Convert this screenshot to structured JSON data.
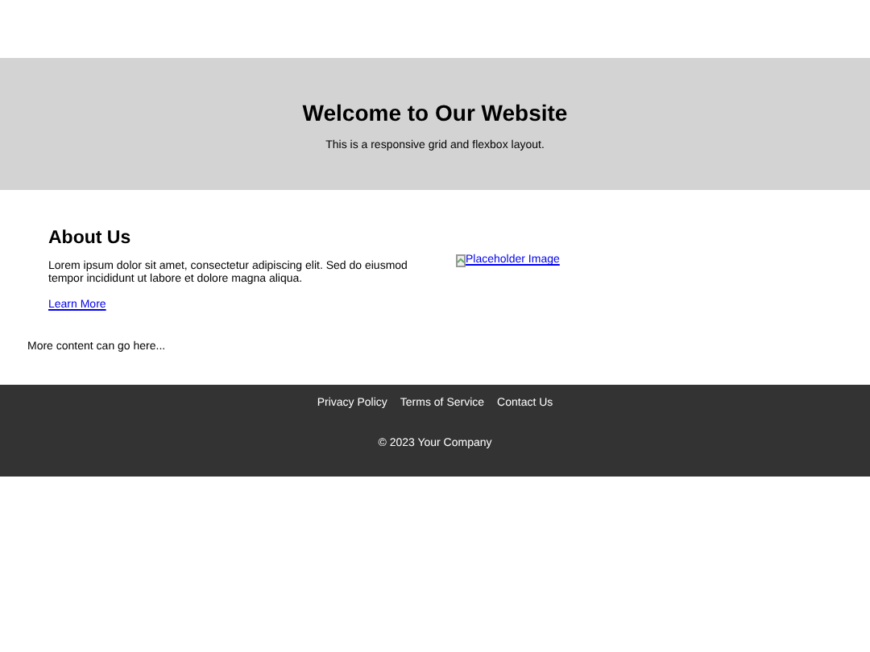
{
  "header": {
    "title": "Welcome to Our Website",
    "subtitle": "This is a responsive grid and flexbox layout."
  },
  "about": {
    "heading": "About Us",
    "text": "Lorem ipsum dolor sit amet, consectetur adipiscing elit. Sed do eiusmod tempor incididunt ut labore et dolore magna aliqua.",
    "link": "Learn More"
  },
  "image": {
    "alt": "Placeholder Image"
  },
  "more": "More content can go here...",
  "footer": {
    "links": [
      "Privacy Policy",
      "Terms of Service",
      "Contact Us"
    ],
    "copyright": "© 2023 Your Company"
  }
}
